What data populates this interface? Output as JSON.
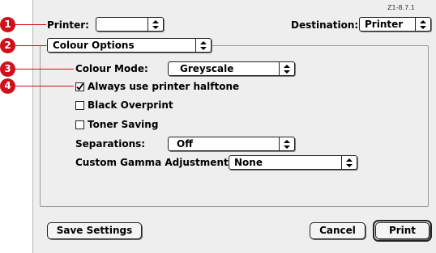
{
  "version_tag": "Z1-8.7.1",
  "callouts": [
    "1",
    "2",
    "3",
    "4"
  ],
  "printer": {
    "label": "Printer:",
    "value": ""
  },
  "destination": {
    "label": "Destination:",
    "value": "Printer"
  },
  "panel_select": {
    "value": "Colour Options"
  },
  "colour_mode": {
    "label": "Colour Mode:",
    "value": "Greyscale"
  },
  "checkboxes": [
    {
      "label": "Always use printer halftone",
      "checked": true
    },
    {
      "label": "Black Overprint",
      "checked": false
    },
    {
      "label": "Toner Saving",
      "checked": false
    }
  ],
  "separations": {
    "label": "Separations:",
    "value": "Off"
  },
  "gamma": {
    "label": "Custom Gamma Adjustment:",
    "value": "None"
  },
  "buttons": {
    "save": "Save Settings",
    "cancel": "Cancel",
    "print": "Print"
  },
  "colors": {
    "callout": "#d0101a",
    "dialog_bg": "#eeeeee"
  }
}
